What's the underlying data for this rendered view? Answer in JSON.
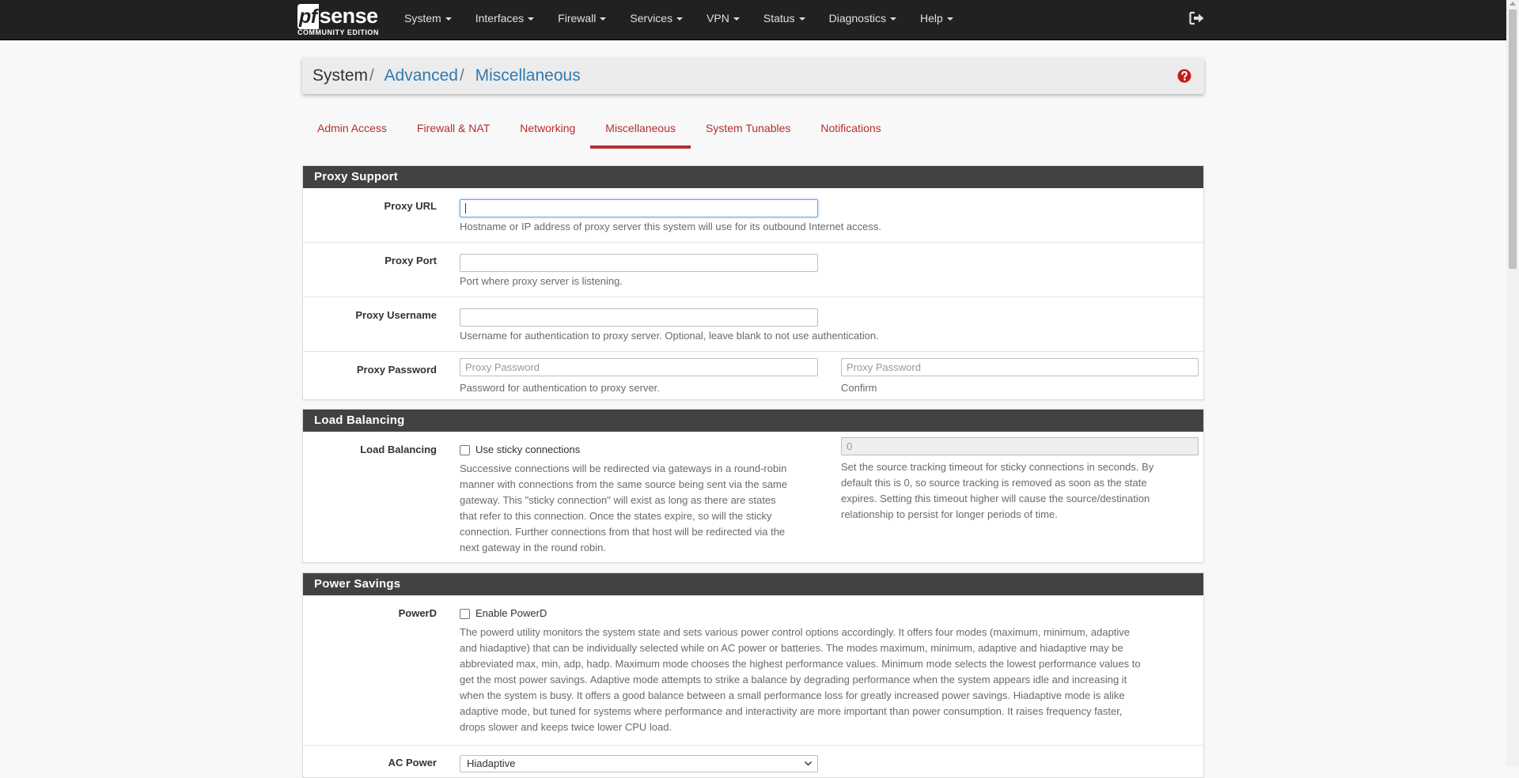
{
  "brand": {
    "logo_text": "sense",
    "logo_prefix": "pf",
    "edition": "COMMUNITY EDITION"
  },
  "nav": {
    "items": [
      {
        "label": "System"
      },
      {
        "label": "Interfaces"
      },
      {
        "label": "Firewall"
      },
      {
        "label": "Services"
      },
      {
        "label": "VPN"
      },
      {
        "label": "Status"
      },
      {
        "label": "Diagnostics"
      },
      {
        "label": "Help"
      }
    ],
    "logout_icon": "sign-out-icon"
  },
  "breadcrumb": {
    "root": "System",
    "level1": "Advanced",
    "level2": "Miscellaneous",
    "help_icon": "question-circle-icon"
  },
  "tabs": [
    {
      "label": "Admin Access",
      "active": false
    },
    {
      "label": "Firewall & NAT",
      "active": false
    },
    {
      "label": "Networking",
      "active": false
    },
    {
      "label": "Miscellaneous",
      "active": true
    },
    {
      "label": "System Tunables",
      "active": false
    },
    {
      "label": "Notifications",
      "active": false
    }
  ],
  "proxy": {
    "heading": "Proxy Support",
    "url": {
      "label": "Proxy URL",
      "value": "",
      "help": "Hostname or IP address of proxy server this system will use for its outbound Internet access."
    },
    "port": {
      "label": "Proxy Port",
      "value": "",
      "help": "Port where proxy server is listening."
    },
    "username": {
      "label": "Proxy Username",
      "value": "",
      "help": "Username for authentication to proxy server. Optional, leave blank to not use authentication."
    },
    "password": {
      "label": "Proxy Password",
      "placeholder": "Proxy Password",
      "help": "Password for authentication to proxy server.",
      "confirm_placeholder": "Proxy Password",
      "confirm_help": "Confirm"
    }
  },
  "load_balancing": {
    "heading": "Load Balancing",
    "label": "Load Balancing",
    "checkbox_label": "Use sticky connections",
    "checked": false,
    "help": [
      "Successive connections will be redirected via gateways in a round-robin",
      "manner with connections from the same source being sent via the same",
      "gateway. This \"sticky connection\" will exist as long as there are states",
      "that refer to this connection. Once the states expire, so will the sticky",
      "connection. Further connections from that host will be redirected via the",
      "next gateway in the round robin."
    ],
    "timeout_placeholder": "0",
    "timeout_help": [
      "Set the source tracking timeout for sticky connections in seconds. By",
      "default this is 0, so source tracking is removed as soon as the state",
      "expires. Setting this timeout higher will cause the source/destination",
      "relationship to persist for longer periods of time."
    ]
  },
  "power": {
    "heading": "Power Savings",
    "label": "PowerD",
    "checkbox_label": "Enable PowerD",
    "checked": false,
    "help": [
      "The powerd utility monitors the system state and sets various power control options accordingly. It offers four modes (maximum, minimum, adaptive",
      "and hiadaptive) that can be individually selected while on AC power or batteries. The modes maximum, minimum, adaptive and hiadaptive may be",
      "abbreviated max, min, adp, hadp. Maximum mode chooses the highest performance values. Minimum mode selects the lowest performance values to",
      "get the most power savings. Adaptive mode attempts to strike a balance by degrading performance when the system appears idle and increasing it",
      "when the system is busy. It offers a good balance between a small performance loss for greatly increased power savings. Hiadaptive mode is alike",
      "adaptive mode, but tuned for systems where performance and interactivity are more important than power consumption. It raises frequency faster,",
      "drops slower and keeps twice lower CPU load."
    ],
    "ac_power": {
      "label": "AC Power",
      "value": "Hiadaptive"
    }
  }
}
